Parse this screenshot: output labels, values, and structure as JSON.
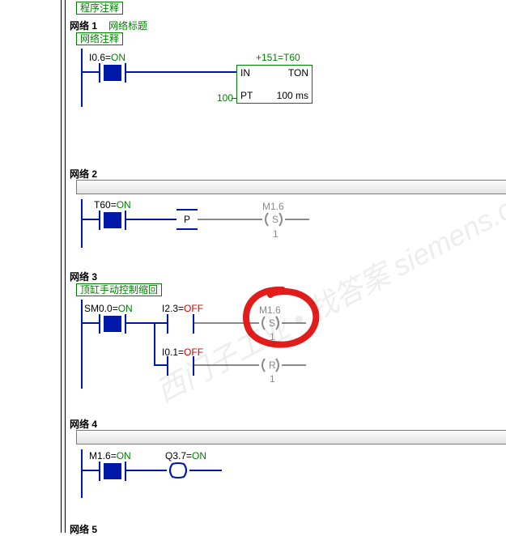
{
  "program_comment": "程序注释",
  "networks": {
    "n1": {
      "title": "网络 1",
      "subtitle": "网络标题",
      "comment": "网络注释",
      "contact1_addr": "I0.6",
      "contact1_state": "ON",
      "timer_top": "+151=T60",
      "timer_in": "IN",
      "timer_type": "TON",
      "timer_pt_label": "PT",
      "timer_pt_val": "100 ms",
      "timer_pt_input": "100"
    },
    "n2": {
      "title": "网络 2",
      "contact1_addr": "T60",
      "contact1_state": "ON",
      "p_label": "P",
      "coil_addr": "M1.6",
      "coil_op": "S",
      "coil_n": "1"
    },
    "n3": {
      "title": "网络 3",
      "comment": "顶缸手动控制缩回",
      "contact1_addr": "SM0.0",
      "contact1_state": "ON",
      "contact2_addr": "I2.3",
      "contact2_state": "OFF",
      "contact3_addr": "I0.1",
      "contact3_state": "OFF",
      "coilS_addr": "M1.6",
      "coilS_op": "S",
      "coilS_n": "1",
      "coilR_op": "R",
      "coilR_n": "1"
    },
    "n4": {
      "title": "网络 4",
      "contact1_addr": "M1.6",
      "contact1_state": "ON",
      "coil_addr": "Q3.7",
      "coil_state": "ON"
    },
    "n5": {
      "title": "网络 5"
    }
  },
  "watermark": "西门子工业 • 找答案  siemens.com/cs"
}
